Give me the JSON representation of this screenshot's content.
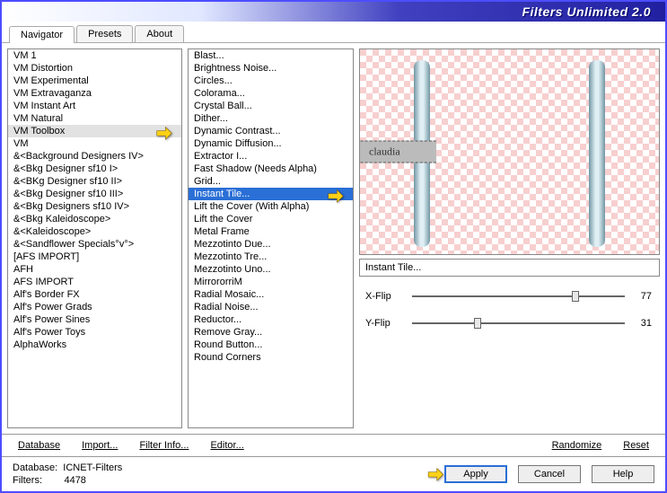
{
  "title": "Filters Unlimited 2.0",
  "tabs": [
    "Navigator",
    "Presets",
    "About"
  ],
  "active_tab": 0,
  "categories": {
    "items": [
      "VM 1",
      "VM Distortion",
      "VM Experimental",
      "VM Extravaganza",
      "VM Instant Art",
      "VM Natural",
      "VM Toolbox",
      "VM",
      "&<Background Designers IV>",
      "&<Bkg Designer sf10 I>",
      "&<BKg Designer sf10 II>",
      "&<Bkg Designer sf10 III>",
      "&<Bkg Designers sf10 IV>",
      "&<Bkg Kaleidoscope>",
      "&<Kaleidoscope>",
      "&<Sandflower Specials°v°>",
      "[AFS IMPORT]",
      "AFH",
      "AFS IMPORT",
      "Alf's Border FX",
      "Alf's Power Grads",
      "Alf's Power Sines",
      "Alf's Power Toys",
      "AlphaWorks"
    ],
    "selected_index": 6
  },
  "filters": {
    "items": [
      "Blast...",
      "Brightness Noise...",
      "Circles...",
      "Colorama...",
      "Crystal Ball...",
      "Dither...",
      "Dynamic Contrast...",
      "Dynamic Diffusion...",
      "Extractor I...",
      "Fast Shadow (Needs Alpha)",
      "Grid...",
      "Instant Tile...",
      "Lift the Cover (With Alpha)",
      "Lift the Cover",
      "Metal Frame",
      "Mezzotinto Due...",
      "Mezzotinto Tre...",
      "Mezzotinto Uno...",
      "MirrororriM",
      "Radial Mosaic...",
      "Radial Noise...",
      "Reductor...",
      "Remove Gray...",
      "Round Button...",
      "Round Corners"
    ],
    "selected_index": 11
  },
  "preview": {
    "filter_name": "Instant Tile...",
    "stamp_text": "claudia"
  },
  "sliders": [
    {
      "label": "X-Flip",
      "value": 77,
      "min": 0,
      "max": 100
    },
    {
      "label": "Y-Flip",
      "value": 31,
      "min": 0,
      "max": 100
    }
  ],
  "toolbar": {
    "database": "Database",
    "import": "Import...",
    "filter_info": "Filter Info...",
    "editor": "Editor...",
    "randomize": "Randomize",
    "reset": "Reset"
  },
  "status": {
    "db_label": "Database:",
    "db_value": "ICNET-Filters",
    "filters_label": "Filters:",
    "filters_value": "4478"
  },
  "buttons": {
    "apply": "Apply",
    "cancel": "Cancel",
    "help": "Help"
  }
}
